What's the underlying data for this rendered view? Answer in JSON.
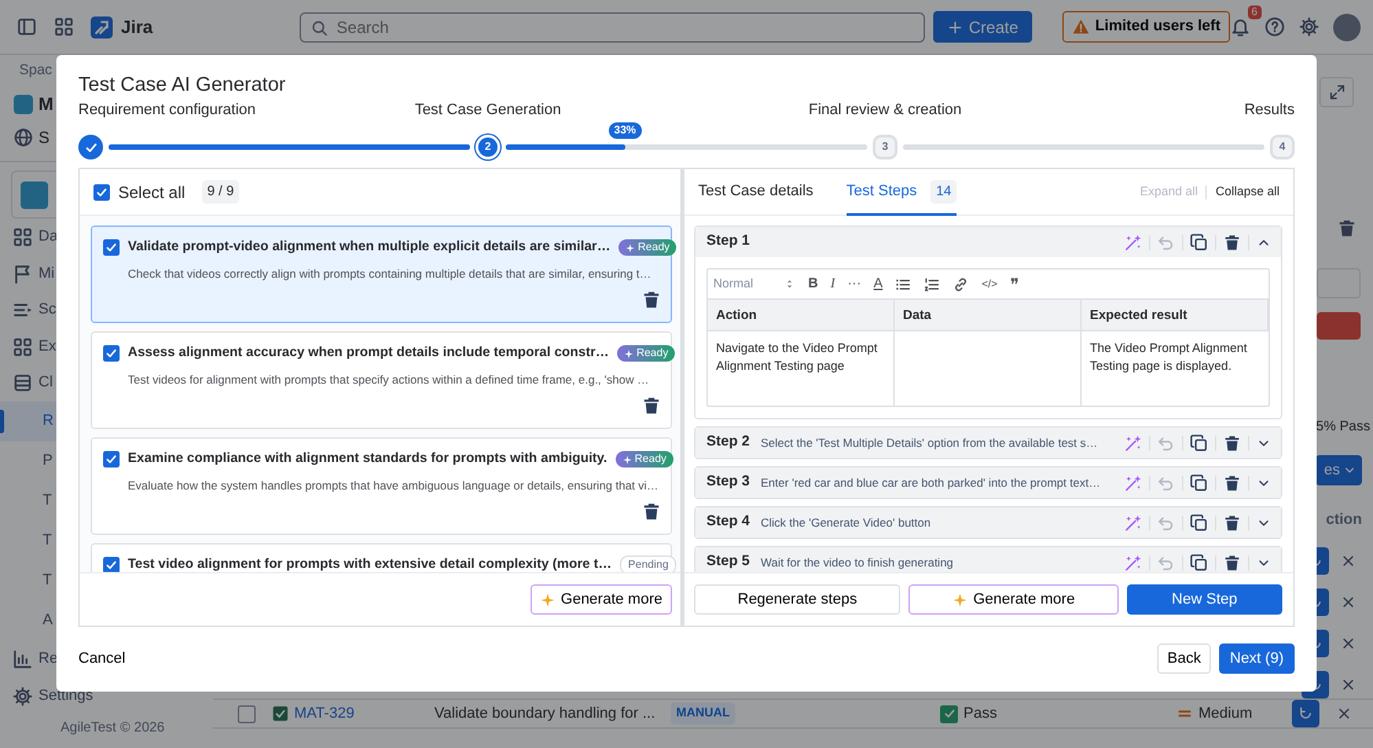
{
  "top_bar": {
    "app_name": "Jira",
    "search_placeholder": "Search",
    "create_label": "Create",
    "notice": "Limited users left",
    "notification_count": "6"
  },
  "sidebar": {
    "section_label": "Spac",
    "project_name": "M",
    "project_link": "S",
    "items": [
      {
        "label": "Da",
        "selected": false
      },
      {
        "label": "Mi",
        "selected": false
      },
      {
        "label": "Sc",
        "selected": false
      },
      {
        "label": "Ex",
        "selected": false
      },
      {
        "label": "Cl",
        "selected": false,
        "children": [
          {
            "label": "R",
            "selected": true
          },
          {
            "label": "P",
            "selected": false
          },
          {
            "label": "T",
            "selected": false
          },
          {
            "label": "T",
            "selected": false
          },
          {
            "label": "T",
            "selected": false
          },
          {
            "label": "A",
            "selected": false
          }
        ]
      },
      {
        "label": "Re",
        "selected": false
      },
      {
        "label": "Settings",
        "selected": false
      }
    ],
    "footer": "AgileTest © 2026"
  },
  "main": {
    "pass_summary": "5% Pass",
    "action_label": "es",
    "column_header": "ction",
    "row": {
      "key": "MAT-329",
      "summary": "Validate boundary handling for ...",
      "type": "MANUAL",
      "status": "Pass",
      "priority": "Medium",
      "checked": false
    }
  },
  "dialog": {
    "title": "Test Case AI Generator",
    "stages": [
      {
        "label": "Requirement configuration",
        "completed": true,
        "selected": false
      },
      {
        "label": "Test Case Generation",
        "number": "2",
        "completed": false,
        "selected": true
      },
      {
        "label": "Final review & creation",
        "number": "3",
        "completed": false,
        "selected": false
      },
      {
        "label": "Results",
        "number": "4",
        "completed": false,
        "selected": false
      }
    ],
    "progress": {
      "level": 0.33,
      "reading": "33%"
    },
    "select_all": {
      "label": "Select all",
      "checked": true,
      "count": "9 / 9"
    },
    "test_cases": [
      {
        "title": "Validate prompt-video alignment when multiple explicit details are similar…",
        "description": "Check that videos correctly align with prompts containing multiple details that are similar, ensuring t…",
        "status": {
          "kind": "ready",
          "label": "Ready"
        },
        "checked": true,
        "selected": true
      },
      {
        "title": "Assess alignment accuracy when prompt details include temporal constr…",
        "description": "Test videos for alignment with prompts that specify actions within a defined time frame, e.g., 'show …",
        "status": {
          "kind": "ready",
          "label": "Ready"
        },
        "checked": true,
        "selected": false
      },
      {
        "title": "Examine compliance with alignment standards for prompts with ambiguity.",
        "description": "Evaluate how the system handles prompts that have ambiguous language or details, ensuring that vi…",
        "status": {
          "kind": "ready",
          "label": "Ready"
        },
        "checked": true,
        "selected": false
      },
      {
        "title": "Test video alignment for prompts with extensive detail complexity (more t…",
        "status": {
          "kind": "pending",
          "label": "Pending"
        },
        "checked": true,
        "selected": false
      }
    ],
    "generate_more_cases": "Generate more",
    "tabs": [
      {
        "label": "Test Case details",
        "selected": false
      },
      {
        "label": "Test Steps",
        "count": "14",
        "selected": true
      }
    ],
    "expand_all": {
      "label": "Expand all",
      "disabled": true
    },
    "collapse_all": {
      "label": "Collapse all",
      "disabled": false
    },
    "test_steps": [
      {
        "label": "Step 1",
        "expanded": true,
        "editor": {
          "format": "Normal",
          "glyphs": [
            "B",
            "I",
            "···",
            "A",
            "</>",
            "❞"
          ],
          "columns": [
            "Action",
            "Data",
            "Expected result"
          ],
          "action": "Navigate to the Video Prompt Alignment Testing page",
          "expected_result": "The Video Prompt Alignment Testing page is displayed."
        }
      },
      {
        "label": "Step 2",
        "summary": "Select the 'Test Multiple Details' option from the available test s…",
        "expanded": false
      },
      {
        "label": "Step 3",
        "summary": "Enter 'red car and blue car are both parked' into the prompt text…",
        "expanded": false
      },
      {
        "label": "Step 4",
        "summary": "Click the 'Generate Video' button",
        "expanded": false
      },
      {
        "label": "Step 5",
        "summary": "Wait for the video to finish generating",
        "expanded": false
      }
    ],
    "step_buttons": {
      "regenerate": "Regenerate steps",
      "generate_more": "Generate more",
      "new_step": "New Step"
    },
    "footer": {
      "cancel": "Cancel",
      "back": "Back",
      "next": "Next (9)"
    }
  }
}
